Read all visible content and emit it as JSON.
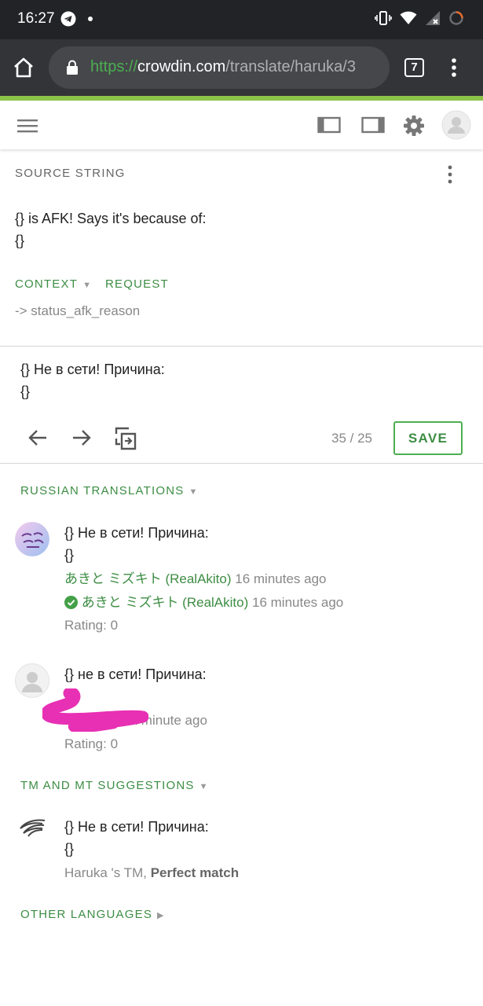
{
  "status_bar": {
    "time": "16:27"
  },
  "browser": {
    "url_scheme": "https://",
    "url_host": "crowdin.com",
    "url_path": "/translate/haruka/3",
    "tab_count": "7"
  },
  "source": {
    "label": "SOURCE STRING",
    "line1": "{} is AFK! Says it's because of:",
    "line2": "{}",
    "context_label": "CONTEXT",
    "request_label": "REQUEST",
    "context_value": "-> status_afk_reason"
  },
  "editor": {
    "line1": "{} Не в сети! Причина:",
    "line2": "{}",
    "char_count": "35 / 25",
    "save_label": "SAVE"
  },
  "russian_translations": {
    "label": "RUSSIAN TRANSLATIONS",
    "items": [
      {
        "line1": "{} Не в сети! Причина:",
        "line2": "{}",
        "author": "あきと ミズキト (RealAkito)",
        "time": "16 minutes ago",
        "approver": "あきと ミズキト (RealAkito)",
        "approve_time": "16 minutes ago",
        "rating": "Rating: 0"
      },
      {
        "line1": "{} не в сети! Причина:",
        "time": "20 a minute ago",
        "rating": "Rating: 0"
      }
    ]
  },
  "suggestions": {
    "label": "TM AND MT SUGGESTIONS",
    "line1": "{} Не в сети! Причина:",
    "line2": "{}",
    "source": "Haruka 's TM,",
    "match": "Perfect match"
  },
  "other_languages": {
    "label": "OTHER LANGUAGES"
  },
  "colors": {
    "accent": "#3d8d44",
    "brand_progress": "#8bc34a",
    "redaction": "#e830b4"
  }
}
